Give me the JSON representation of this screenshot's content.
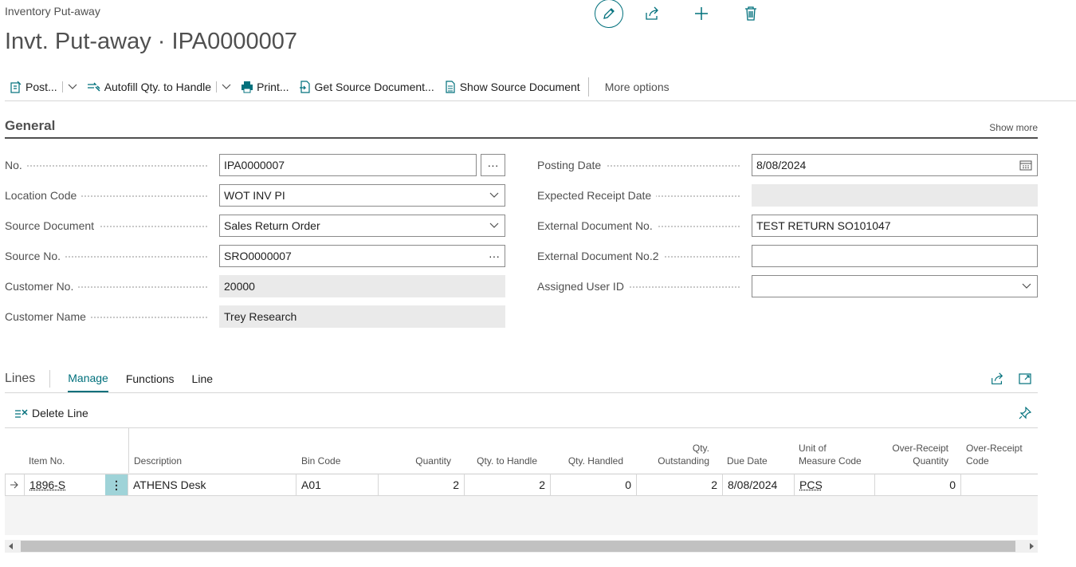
{
  "breadcrumb": "Inventory Put-away",
  "title": "Invt. Put-away · IPA0000007",
  "actions": {
    "post": "Post...",
    "autofill": "Autofill Qty. to Handle",
    "print": "Print...",
    "get_source": "Get Source Document...",
    "show_source": "Show Source Document",
    "more": "More options"
  },
  "general": {
    "title": "General",
    "show_more": "Show more",
    "no_label": "No.",
    "no_value": "IPA0000007",
    "location_label": "Location Code",
    "location_value": "WOT INV PI",
    "source_doc_label": "Source Document",
    "source_doc_value": "Sales Return Order",
    "source_no_label": "Source No.",
    "source_no_value": "SRO0000007",
    "customer_no_label": "Customer No.",
    "customer_no_value": "20000",
    "customer_name_label": "Customer Name",
    "customer_name_value": "Trey Research",
    "posting_date_label": "Posting Date",
    "posting_date_value": "8/08/2024",
    "expected_receipt_label": "Expected Receipt Date",
    "expected_receipt_value": "",
    "ext_doc_label": "External Document No.",
    "ext_doc_value": "TEST RETURN SO101047",
    "ext_doc2_label": "External Document No.2",
    "ext_doc2_value": "",
    "assigned_user_label": "Assigned User ID",
    "assigned_user_value": ""
  },
  "lines": {
    "title": "Lines",
    "tabs": [
      "Manage",
      "Functions",
      "Line"
    ],
    "delete_line": "Delete Line",
    "columns": {
      "item_no": "Item No.",
      "description": "Description",
      "bin_code": "Bin Code",
      "quantity": "Quantity",
      "qty_to_handle": "Qty. to Handle",
      "qty_handled": "Qty. Handled",
      "qty_outstanding_1": "Qty.",
      "qty_outstanding_2": "Outstanding",
      "due_date": "Due Date",
      "uom_1": "Unit of",
      "uom_2": "Measure Code",
      "over_qty_1": "Over-Receipt",
      "over_qty_2": "Quantity",
      "over_code_1": "Over-Receipt",
      "over_code_2": "Code"
    },
    "row": {
      "item_no": "1896-S",
      "description": "ATHENS Desk",
      "bin_code": "A01",
      "quantity": "2",
      "qty_to_handle": "2",
      "qty_handled": "0",
      "qty_outstanding": "2",
      "due_date": "8/08/2024",
      "uom": "PCS",
      "over_qty": "0",
      "over_code": ""
    }
  },
  "colors": {
    "accent": "#00707c",
    "readonly": "#eaeaea",
    "selected_cell": "#9fd3d8"
  }
}
